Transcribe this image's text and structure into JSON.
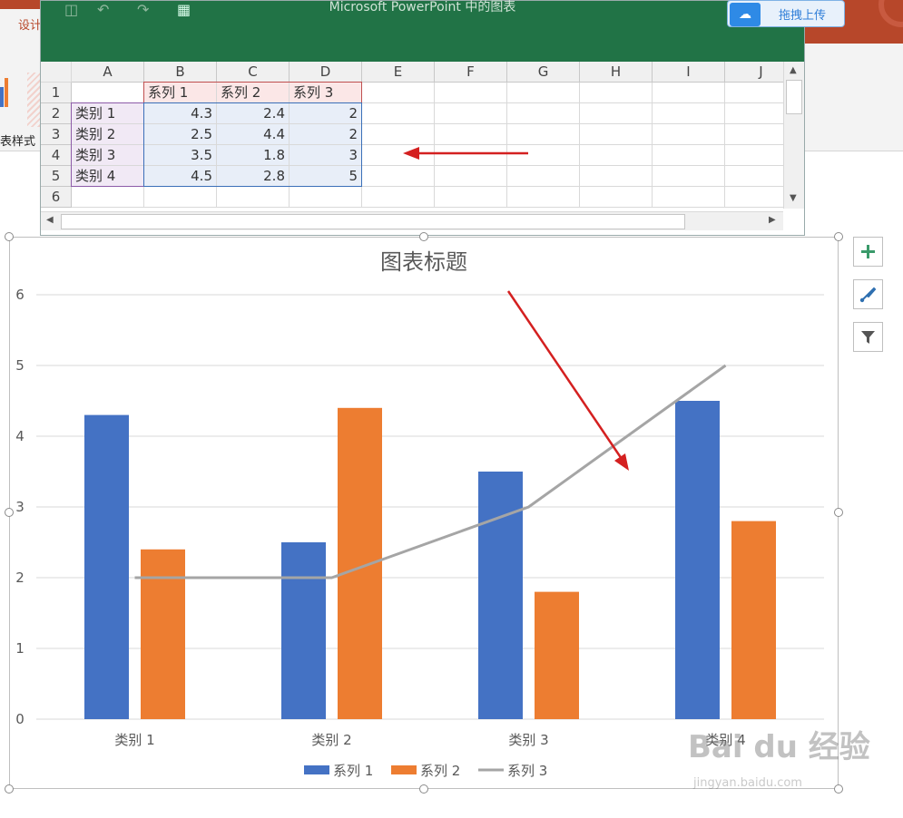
{
  "ppt": {
    "design_tab": "设计",
    "chart_styles_label": "表样式"
  },
  "excel": {
    "title": "Microsoft PowerPoint 中的图表",
    "upload_button": "拖拽上传",
    "columns": [
      "A",
      "B",
      "C",
      "D",
      "E",
      "F",
      "G",
      "H",
      "I",
      "J"
    ],
    "rows": [
      "1",
      "2",
      "3",
      "4",
      "5",
      "6"
    ],
    "header_row": [
      "",
      "系列 1",
      "系列 2",
      "系列 3"
    ],
    "data_rows": [
      [
        "类别 1",
        "4.3",
        "2.4",
        "2"
      ],
      [
        "类别 2",
        "2.5",
        "4.4",
        "2"
      ],
      [
        "类别 3",
        "3.5",
        "1.8",
        "3"
      ],
      [
        "类别 4",
        "4.5",
        "2.8",
        "5"
      ]
    ]
  },
  "chart_data": {
    "type": "bar",
    "title": "图表标题",
    "categories": [
      "类别 1",
      "类别 2",
      "类别 3",
      "类别 4"
    ],
    "series": [
      {
        "name": "系列 1",
        "type": "bar",
        "values": [
          4.3,
          2.5,
          3.5,
          4.5
        ],
        "color": "#4472c4"
      },
      {
        "name": "系列 2",
        "type": "bar",
        "values": [
          2.4,
          4.4,
          1.8,
          2.8
        ],
        "color": "#ed7d31"
      },
      {
        "name": "系列 3",
        "type": "line",
        "values": [
          2,
          2,
          3,
          5
        ],
        "color": "#a5a5a5"
      }
    ],
    "ylim": [
      0,
      6
    ],
    "yticks": [
      "0",
      "1",
      "2",
      "3",
      "4",
      "5",
      "6"
    ],
    "grid": true,
    "legend": "bottom"
  },
  "watermark": {
    "brand": "Bai du 经验",
    "url": "jingyan.baidu.com"
  },
  "icons": {
    "add_element": "plus-icon",
    "chart_style": "brush-icon",
    "chart_filter": "filter-icon"
  },
  "colors": {
    "excel_green": "#217346",
    "ppt_red": "#b7472a",
    "annotation_arrow": "#d42020"
  }
}
